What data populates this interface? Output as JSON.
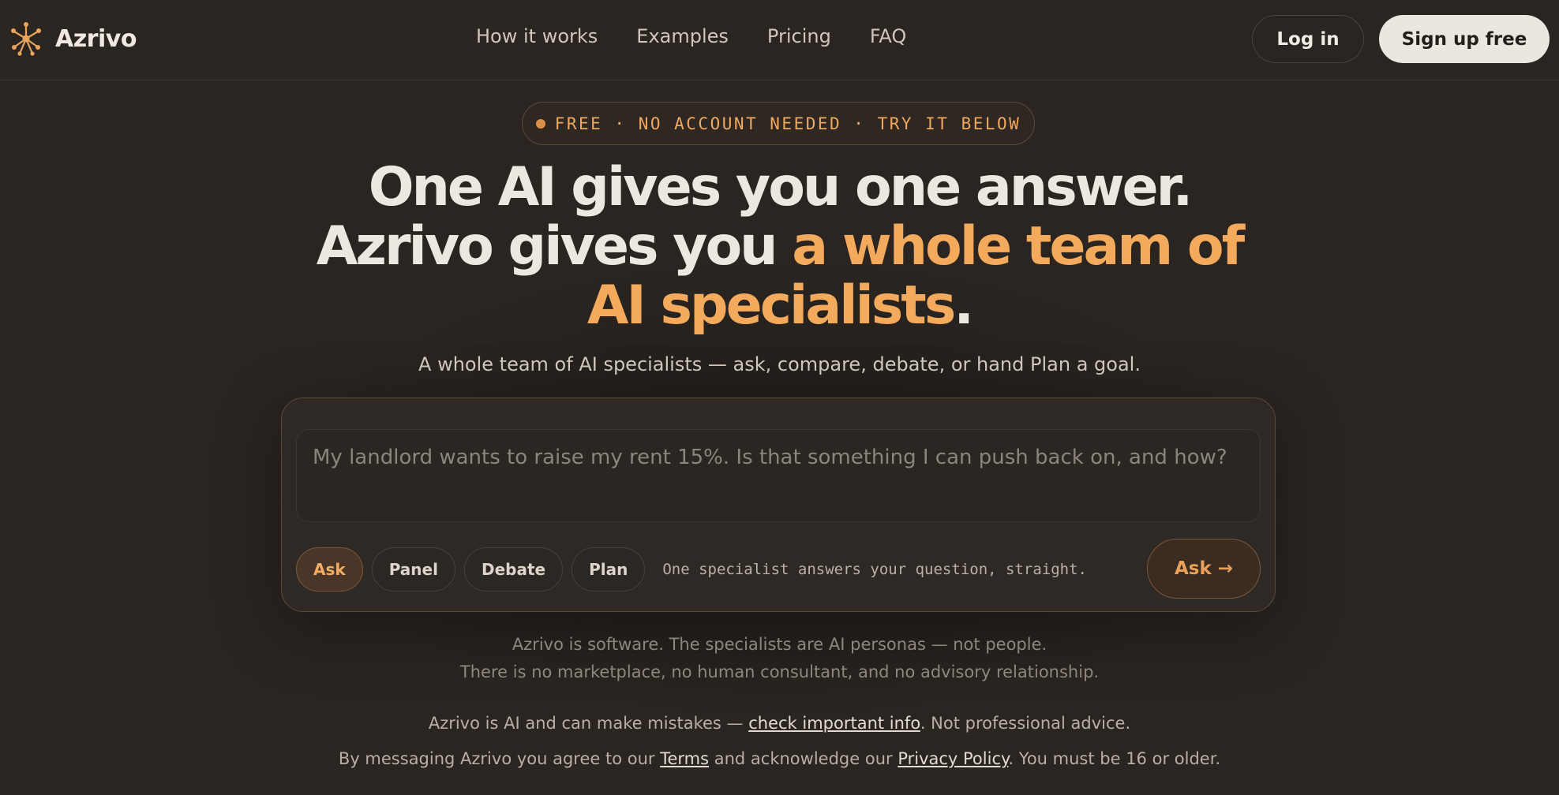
{
  "brand": {
    "name": "Azrivo",
    "logo_icon": "network-node-icon",
    "accent": "#f4aa5c"
  },
  "nav": {
    "items": [
      "How it works",
      "Examples",
      "Pricing",
      "FAQ"
    ]
  },
  "header_actions": {
    "login": "Log in",
    "signup": "Sign up free"
  },
  "badge": {
    "text": "FREE · NO ACCOUNT NEEDED · TRY IT BELOW"
  },
  "hero": {
    "line1": "One AI gives you one answer.",
    "line2_plain": "Azrivo gives you ",
    "line2_accent": "a whole team of",
    "line3_accent": "AI specialists",
    "line3_end": "."
  },
  "subtitle": "A whole team of AI specialists — ask, compare, debate, or hand Plan a goal.",
  "composer": {
    "placeholder": "My landlord wants to raise my rent 15%. Is that something I can push back on, and how?",
    "modes": [
      "Ask",
      "Panel",
      "Debate",
      "Plan"
    ],
    "active_mode": "Ask",
    "mode_description": "One specialist answers your question, straight.",
    "submit": "Ask →"
  },
  "disclaimer": {
    "line1": "Azrivo is software. The specialists are AI personas — not people.",
    "line2": "There is no marketplace, no human consultant, and no advisory relationship."
  },
  "legal": {
    "ai_before": "Azrivo is AI and can make mistakes — ",
    "ai_link": "check important info",
    "ai_after": ". Not professional advice.",
    "terms_before": "By messaging Azrivo you agree to our ",
    "terms_link": "Terms",
    "terms_middle": " and acknowledge our ",
    "privacy_link": "Privacy Policy",
    "terms_after": ". You must be 16 or older."
  }
}
